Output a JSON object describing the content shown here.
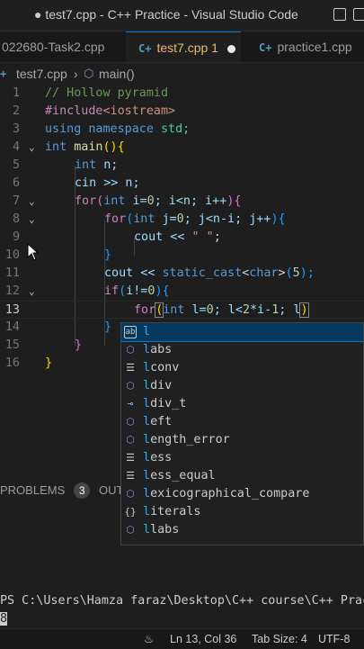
{
  "window": {
    "title": "● test7.cpp - C++ Practice - Visual Studio Code",
    "layout_icons": [
      "toggle-sidebar-icon",
      "toggle-panel-icon"
    ]
  },
  "tabs": [
    {
      "label": "022680-Task2.cpp",
      "active": false
    },
    {
      "label": "test7.cpp 1",
      "active": true,
      "modified": true
    },
    {
      "label": "practice1.cpp",
      "active": false
    }
  ],
  "breadcrumb": {
    "file": "test7.cpp",
    "separator": "›",
    "symbol": "main()"
  },
  "editor": {
    "line_numbers": [
      "1",
      "2",
      "3",
      "4",
      "5",
      "6",
      "7",
      "8",
      "9",
      "10",
      "11",
      "12",
      "13",
      "14",
      "15",
      "16"
    ],
    "folds": {
      "4": "⌄",
      "7": "⌄",
      "8": "⌄",
      "12": "⌄"
    },
    "code": {
      "l1_comment": "// Hollow pyramid",
      "l2_include": "#include",
      "l2_header": "<iostream>",
      "l3_using": "using",
      "l3_namespace": "namespace",
      "l3_std": "std;",
      "l4_int": "int",
      "l4_main": "main",
      "l4_rest": "(){",
      "l5_int": "int",
      "l5_n": "n;",
      "l6_cin": "cin >> n;",
      "l7_for": "for",
      "l7_p1": "(",
      "l7_int": "int",
      "l7_rest1": " i=",
      "l7_zero": "0",
      "l7_rest2": "; i<n; i++",
      "l7_p2": "){",
      "l8_for": "for",
      "l8_p1": "(",
      "l8_int": "int",
      "l8_rest1": " j=",
      "l8_zero": "0",
      "l8_rest2": "; j<n-i; j++",
      "l8_p2": "){",
      "l9_cout": "cout << ",
      "l9_str": "\" \"",
      "l9_end": ";",
      "l10_close": "}",
      "l11_cout": "cout << ",
      "l11_cast": "static_cast",
      "l11_lt": "<",
      "l11_char": "char",
      "l11_gt": ">",
      "l11_p1": "(",
      "l11_five": "5",
      "l11_p2": ");",
      "l12_if": "if",
      "l12_p1": "(",
      "l12_mid": "i!=",
      "l12_zero": "0",
      "l12_p2": "){",
      "l13_for": "for",
      "l13_p1": "(",
      "l13_int": "int",
      "l13_rest1": " l=",
      "l13_zero": "0",
      "l13_rest2": "; l<",
      "l13_two": "2",
      "l13_rest3": "*i-",
      "l13_one": "1",
      "l13_rest4": "; l",
      "l13_p2": ")",
      "l14_close": "}",
      "l15_close": "}",
      "l16_close": "}"
    }
  },
  "suggestions": [
    {
      "match": "l",
      "rest": "",
      "icon": "keyword-icon",
      "selected": true
    },
    {
      "match": "l",
      "rest": "abs",
      "icon": "cube-icon"
    },
    {
      "match": "l",
      "rest": "conv",
      "icon": "struct-icon"
    },
    {
      "match": "l",
      "rest": "div",
      "icon": "cube-icon"
    },
    {
      "match": "l",
      "rest": "div_t",
      "icon": "interface-icon"
    },
    {
      "match": "l",
      "rest": "eft",
      "icon": "cube-icon"
    },
    {
      "match": "l",
      "rest": "ength_error",
      "icon": "cube-icon"
    },
    {
      "match": "l",
      "rest": "ess",
      "icon": "struct-icon"
    },
    {
      "match": "l",
      "rest": "ess_equal",
      "icon": "struct-icon"
    },
    {
      "match": "l",
      "rest": "exicographical_compare",
      "icon": "cube-icon"
    },
    {
      "match": "l",
      "rest": "iterals",
      "icon": "namespace-icon"
    },
    {
      "match": "l",
      "rest": "labs",
      "icon": "cube-icon"
    }
  ],
  "panel": {
    "problems_label": "PROBLEMS",
    "problems_count": "3",
    "output_label": "OUT"
  },
  "terminal": {
    "line1": "PS C:\\Users\\Hamza faraz\\Desktop\\C++ course\\C++ Pract",
    "line2": "8"
  },
  "statusbar": {
    "cursor_pos": "Ln 13, Col 36",
    "tab_size": "Tab Size: 4",
    "encoding": "UTF-8"
  },
  "colors": {
    "accent": "#0078d4",
    "modified_tab": "#e8b86b",
    "suggest_highlight": "#2aaaff"
  }
}
